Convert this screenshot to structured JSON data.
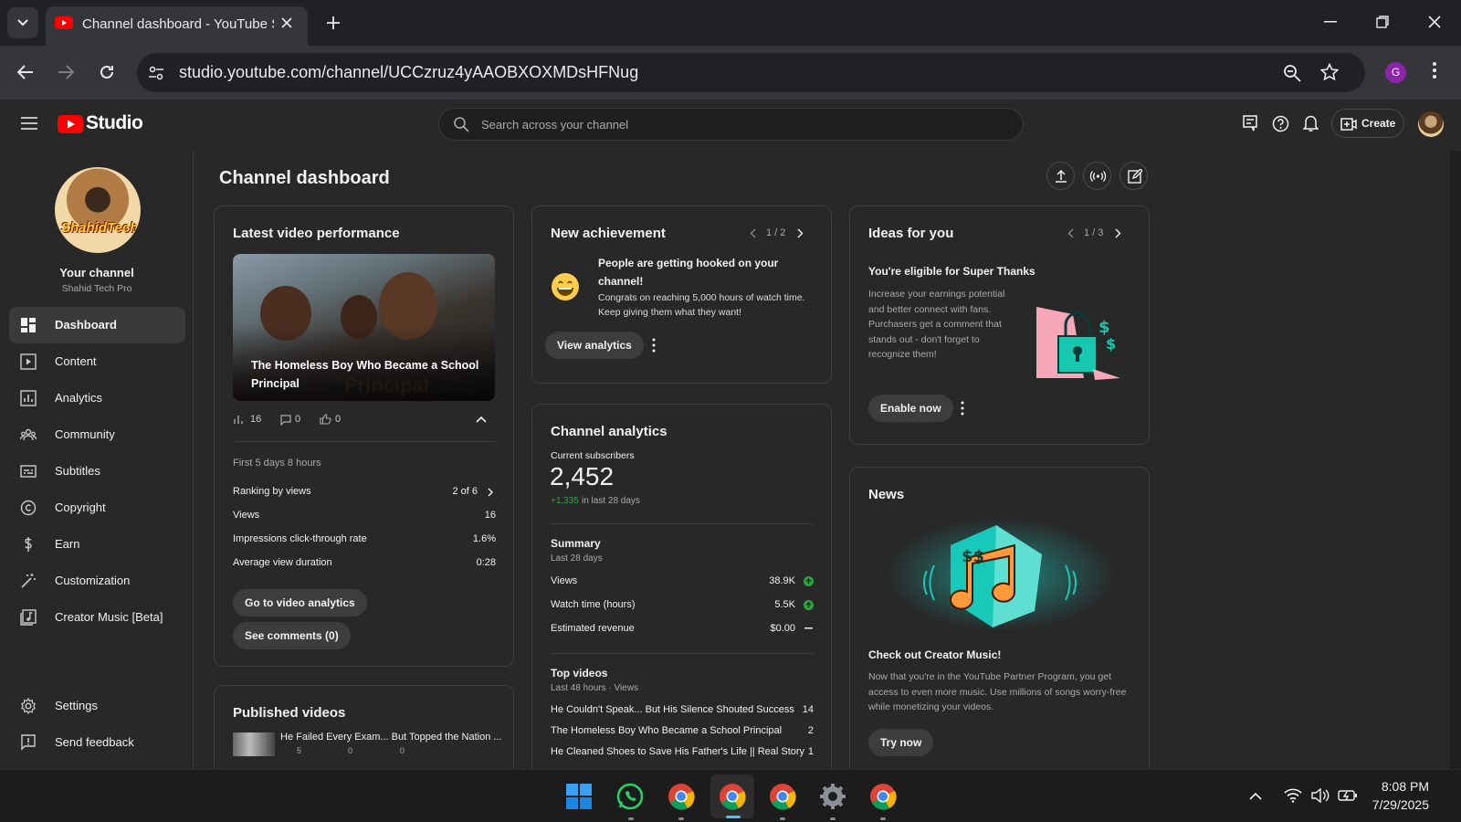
{
  "browser": {
    "tab_title": "Channel dashboard - YouTube Studio",
    "url": "studio.youtube.com/channel/UCCzruz4yAAOBXOXMDsHFNug",
    "profile_initial": "G"
  },
  "studio": {
    "logo_text": "Studio",
    "search_placeholder": "Search across your channel",
    "create_label": "Create",
    "page_title": "Channel dashboard"
  },
  "channel": {
    "heading": "Your channel",
    "name": "Shahid Tech Pro",
    "avatar_text": "ShahidTech"
  },
  "sidebar": {
    "items": [
      {
        "label": "Dashboard",
        "icon": "dashboard-icon"
      },
      {
        "label": "Content",
        "icon": "content-icon"
      },
      {
        "label": "Analytics",
        "icon": "analytics-icon"
      },
      {
        "label": "Community",
        "icon": "community-icon"
      },
      {
        "label": "Subtitles",
        "icon": "subtitles-icon"
      },
      {
        "label": "Copyright",
        "icon": "copyright-icon"
      },
      {
        "label": "Earn",
        "icon": "earn-icon"
      },
      {
        "label": "Customization",
        "icon": "customization-icon"
      },
      {
        "label": "Creator Music [Beta]",
        "icon": "creator-music-icon"
      }
    ],
    "settings": "Settings",
    "feedback": "Send feedback"
  },
  "latest_video": {
    "title": "Latest video performance",
    "video_title": "The Homeless Boy Who Became a School Principal",
    "thumb_overlay": "Principal",
    "views": "16",
    "comments": "0",
    "likes": "0",
    "period": "First 5 days 8 hours",
    "rows": [
      {
        "label": "Ranking by views",
        "value": "2 of 6"
      },
      {
        "label": "Views",
        "value": "16"
      },
      {
        "label": "Impressions click-through rate",
        "value": "1.6%"
      },
      {
        "label": "Average view duration",
        "value": "0:28"
      }
    ],
    "btn_analytics": "Go to video analytics",
    "btn_comments": "See comments (0)"
  },
  "published": {
    "title": "Published videos",
    "first_video": "He Failed Every Exam... But Topped the Nation ...",
    "first_views": "5",
    "first_comments": "0",
    "first_likes": "0"
  },
  "achievement": {
    "title": "New achievement",
    "pager": "1 / 2",
    "headline": "People are getting hooked on your channel!",
    "body": "Congrats on reaching 5,000 hours of watch time. Keep giving them what they want!",
    "button": "View analytics"
  },
  "analytics": {
    "title": "Channel analytics",
    "subs_label": "Current subscribers",
    "subs_value": "2,452",
    "subs_delta": "+1,335",
    "subs_delta_suffix": "in last 28 days",
    "summary_title": "Summary",
    "summary_period": "Last 28 days",
    "summary": [
      {
        "label": "Views",
        "value": "38.9K",
        "trend": "up"
      },
      {
        "label": "Watch time (hours)",
        "value": "5.5K",
        "trend": "up"
      },
      {
        "label": "Estimated revenue",
        "value": "$0.00",
        "trend": "flat"
      }
    ],
    "top_title": "Top videos",
    "top_period": "Last 48 hours · Views",
    "top_videos": [
      {
        "title": "He Couldn't Speak... But His Silence Shouted Success",
        "views": "14"
      },
      {
        "title": "The Homeless Boy Who Became a School Principal",
        "views": "2"
      },
      {
        "title": "He Cleaned Shoes to Save His Father's Life || Real Story",
        "views": "1"
      }
    ]
  },
  "ideas": {
    "title": "Ideas for you",
    "pager": "1 / 3",
    "headline": "You're eligible for Super Thanks",
    "body": "Increase your earnings potential and better connect with fans. Purchasers get a comment that stands out - don't forget to recognize them!",
    "button": "Enable now"
  },
  "news": {
    "title": "News",
    "headline": "Check out Creator Music!",
    "body": "Now that you're in the YouTube Partner Program, you get access to even more music. Use millions of songs worry-free while monetizing your videos.",
    "button": "Try now"
  },
  "taskbar": {
    "time": "8:08 PM",
    "date": "7/29/2025"
  },
  "colors": {
    "accent_red": "#ff0000",
    "positive_green": "#2ba640",
    "background": "#282828"
  }
}
